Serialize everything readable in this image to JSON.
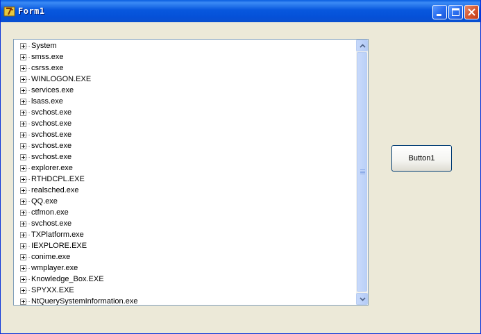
{
  "window": {
    "title": "Form1",
    "icon": "delphi-app-icon",
    "controls": [
      "minimize-icon",
      "maximize-icon",
      "close-icon"
    ]
  },
  "tree": {
    "expander_icon": "plus-box-icon",
    "items": [
      {
        "label": "System"
      },
      {
        "label": "smss.exe"
      },
      {
        "label": "csrss.exe"
      },
      {
        "label": "WINLOGON.EXE"
      },
      {
        "label": "services.exe"
      },
      {
        "label": "lsass.exe"
      },
      {
        "label": "svchost.exe"
      },
      {
        "label": "svchost.exe"
      },
      {
        "label": "svchost.exe"
      },
      {
        "label": "svchost.exe"
      },
      {
        "label": "svchost.exe"
      },
      {
        "label": "explorer.exe"
      },
      {
        "label": "RTHDCPL.EXE"
      },
      {
        "label": "realsched.exe"
      },
      {
        "label": "QQ.exe"
      },
      {
        "label": "ctfmon.exe"
      },
      {
        "label": "svchost.exe"
      },
      {
        "label": "TXPlatform.exe"
      },
      {
        "label": "IEXPLORE.EXE"
      },
      {
        "label": "conime.exe"
      },
      {
        "label": "wmplayer.exe"
      },
      {
        "label": "Knowledge_Box.EXE"
      },
      {
        "label": "SPYXX.EXE"
      },
      {
        "label": "NtQuerySystemInformation.exe"
      }
    ]
  },
  "button1": {
    "label": "Button1"
  },
  "colors": {
    "titlebar": "#0858de",
    "window_bg": "#ece9d8",
    "close_button": "#d65a32"
  }
}
